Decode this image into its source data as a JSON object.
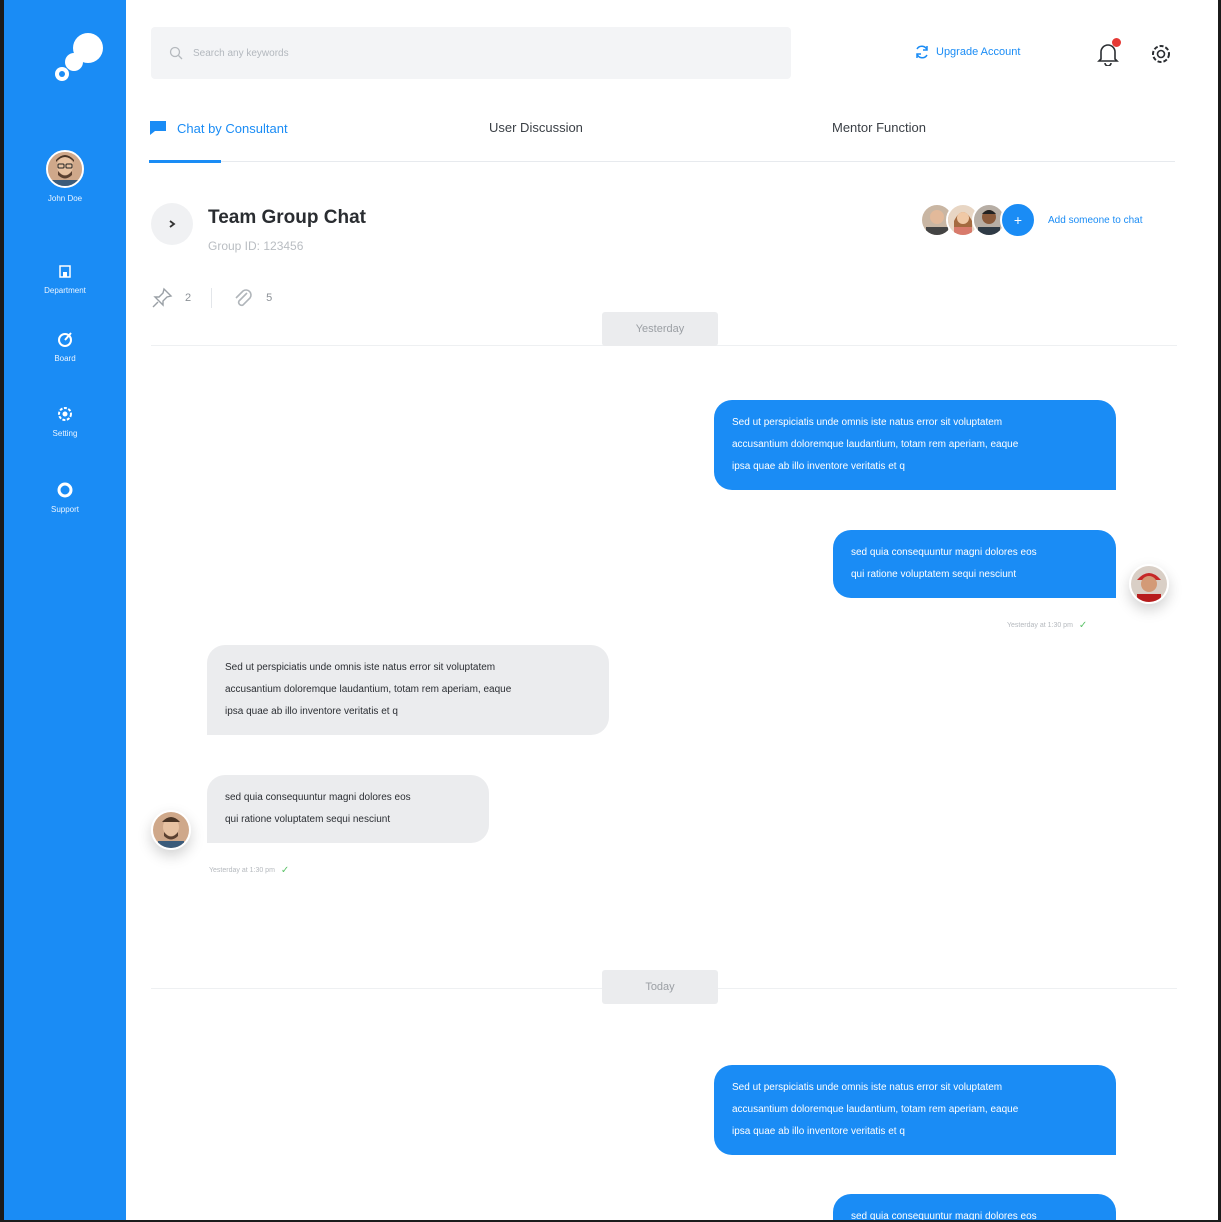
{
  "sidebar": {
    "user_name": "John Doe",
    "items": [
      {
        "label": "Department",
        "icon": "building-icon"
      },
      {
        "label": "Board",
        "icon": "board-icon"
      },
      {
        "label": "Setting",
        "icon": "gear-icon"
      },
      {
        "label": "Support",
        "icon": "support-icon"
      }
    ]
  },
  "topbar": {
    "search_placeholder": "Search any keywords",
    "upgrade_label": "Upgrade Account",
    "notification_count": 1
  },
  "tabs": [
    {
      "label": "Chat by Consultant",
      "active": true
    },
    {
      "label": "User Discussion",
      "active": false
    },
    {
      "label": "Mentor Function",
      "active": false
    }
  ],
  "chat": {
    "title": "Team Group Chat",
    "group_id": "Group ID: 123456",
    "add_label": "Add someone to chat",
    "add_symbol": "+",
    "pinned_count": "2",
    "attachment_count": "5"
  },
  "dates": {
    "yesterday": "Yesterday",
    "today": "Today"
  },
  "messages": [
    {
      "side": "out",
      "lines": [
        "Sed ut perspiciatis unde omnis iste natus error sit voluptatem",
        "accusantium doloremque laudantium, totam rem aperiam, eaque",
        "ipsa quae ab illo inventore veritatis et q"
      ]
    },
    {
      "side": "out",
      "lines": [
        "sed quia consequuntur magni dolores eos",
        "qui ratione voluptatem sequi nesciunt"
      ],
      "timestamp": "Yesterday at 1:30 pm"
    },
    {
      "side": "in",
      "lines": [
        "Sed ut perspiciatis unde omnis iste natus error sit voluptatem",
        "accusantium doloremque laudantium, totam rem aperiam, eaque",
        "ipsa quae ab illo inventore veritatis et q"
      ]
    },
    {
      "side": "in",
      "lines": [
        "sed quia consequuntur magni dolores eos",
        "qui ratione voluptatem sequi nesciunt"
      ],
      "timestamp": "Yesterday at 1:30 pm"
    },
    {
      "side": "out",
      "lines": [
        "Sed ut perspiciatis unde omnis iste natus error sit voluptatem",
        "accusantium doloremque laudantium, totam rem aperiam, eaque",
        "ipsa quae ab illo inventore veritatis et q"
      ]
    },
    {
      "side": "out",
      "lines": [
        "sed quia consequuntur magni dolores eos"
      ]
    }
  ],
  "colors": {
    "accent": "#1a8cf5",
    "bubble_in": "#ebecee",
    "notification": "#e53935",
    "check": "#5fc36b"
  }
}
